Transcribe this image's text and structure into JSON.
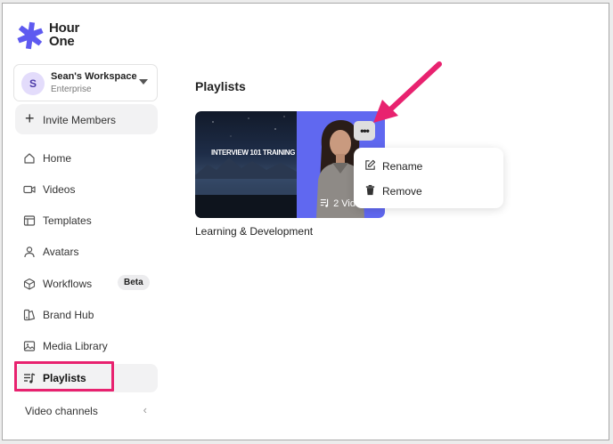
{
  "brand": {
    "logo_text": "Hour\nOne",
    "logo_color": "#5e5af0"
  },
  "workspace": {
    "avatar_letter": "S",
    "name": "Sean's Workspace",
    "plan": "Enterprise"
  },
  "invite": {
    "label": "Invite Members"
  },
  "nav": {
    "items": [
      {
        "label": "Home",
        "icon": "home-icon"
      },
      {
        "label": "Videos",
        "icon": "video-camera-icon"
      },
      {
        "label": "Templates",
        "icon": "template-icon"
      },
      {
        "label": "Avatars",
        "icon": "person-icon"
      },
      {
        "label": "Workflows",
        "icon": "cube-icon",
        "badge": "Beta"
      },
      {
        "label": "Brand Hub",
        "icon": "brand-hub-icon"
      },
      {
        "label": "Media Library",
        "icon": "image-icon"
      },
      {
        "label": "Playlists",
        "icon": "playlist-icon",
        "active": true
      }
    ],
    "video_channels": "Video channels"
  },
  "main": {
    "title": "Playlists",
    "playlists": [
      {
        "title": "Learning & Development",
        "thumbnail_text": "INTERVIEW 101 TRAINING",
        "count_label": "2 Vid"
      }
    ],
    "menu": {
      "rename": "Rename",
      "remove": "Remove"
    }
  },
  "annotation_color": "#e8226f"
}
